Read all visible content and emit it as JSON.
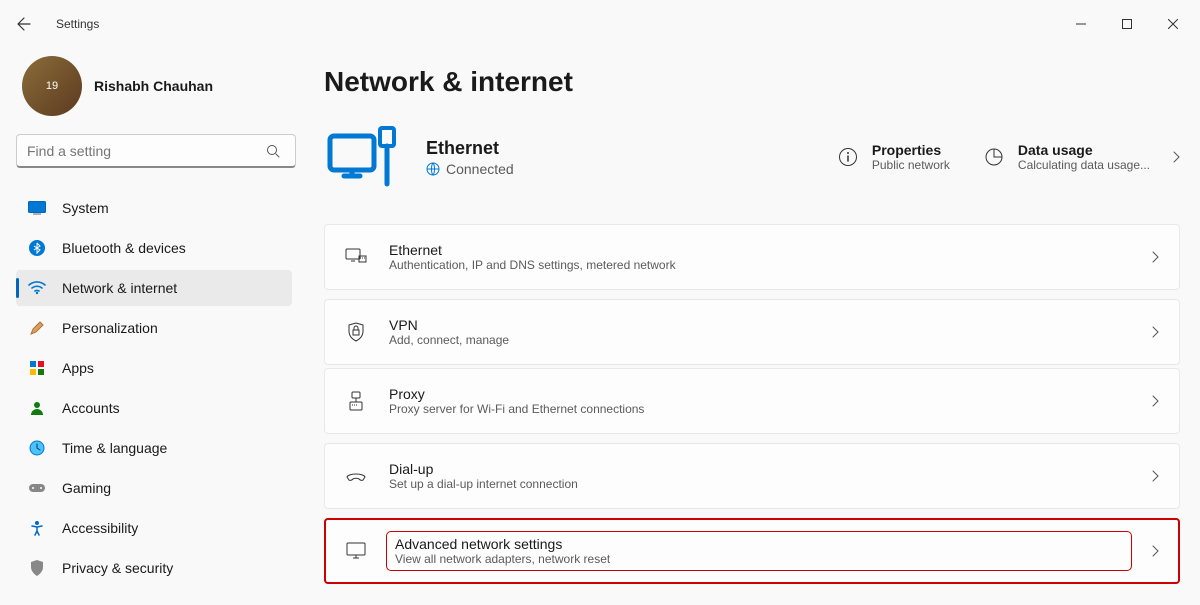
{
  "window": {
    "title": "Settings"
  },
  "user": {
    "name": "Rishabh Chauhan",
    "avatar_badge": "19"
  },
  "search": {
    "placeholder": "Find a setting"
  },
  "sidebar": {
    "items": [
      {
        "label": "System"
      },
      {
        "label": "Bluetooth & devices"
      },
      {
        "label": "Network & internet"
      },
      {
        "label": "Personalization"
      },
      {
        "label": "Apps"
      },
      {
        "label": "Accounts"
      },
      {
        "label": "Time & language"
      },
      {
        "label": "Gaming"
      },
      {
        "label": "Accessibility"
      },
      {
        "label": "Privacy & security"
      }
    ]
  },
  "page": {
    "title": "Network & internet",
    "hero": {
      "title": "Ethernet",
      "status": "Connected"
    },
    "properties": {
      "title": "Properties",
      "sub": "Public network"
    },
    "data_usage": {
      "title": "Data usage",
      "sub": "Calculating data usage..."
    },
    "cards": [
      {
        "title": "Ethernet",
        "sub": "Authentication, IP and DNS settings, metered network"
      },
      {
        "title": "VPN",
        "sub": "Add, connect, manage"
      },
      {
        "title": "Proxy",
        "sub": "Proxy server for Wi-Fi and Ethernet connections"
      },
      {
        "title": "Dial-up",
        "sub": "Set up a dial-up internet connection"
      },
      {
        "title": "Advanced network settings",
        "sub": "View all network adapters, network reset"
      }
    ]
  }
}
